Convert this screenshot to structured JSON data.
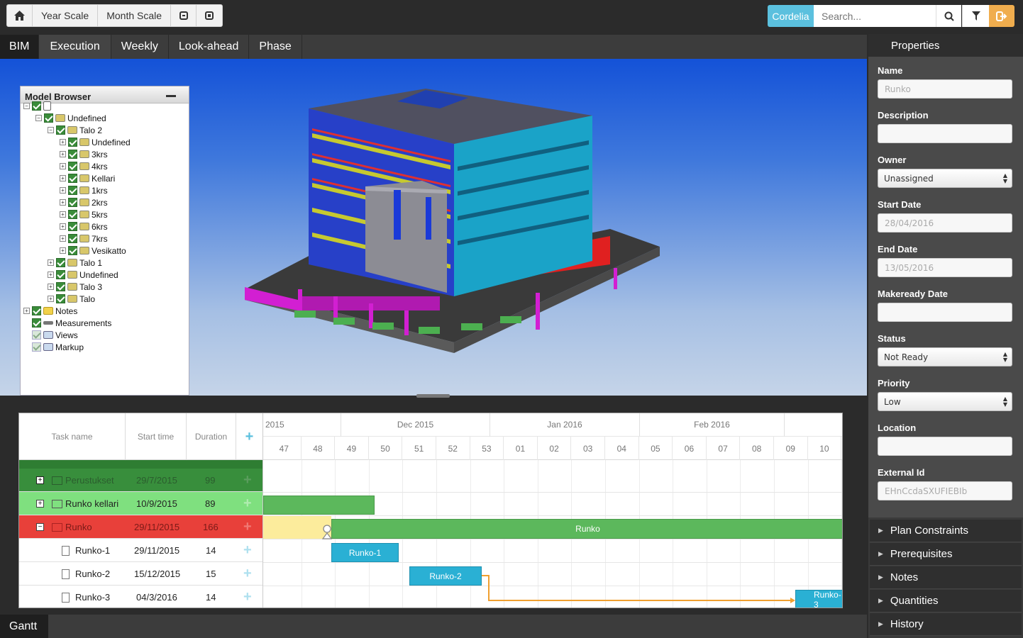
{
  "toolbar": {
    "home_icon": "home-icon",
    "year_scale": "Year Scale",
    "month_scale": "Month Scale",
    "expand_icon": "collapse-square-icon",
    "collapse_icon": "expand-square-icon",
    "user": "Cordelia",
    "search_placeholder": "Search...",
    "search_icon": "search-icon",
    "filter_icon": "filter-icon",
    "logout_icon": "sign-out-icon"
  },
  "tabs": [
    "BIM",
    "Execution",
    "Weekly",
    "Look-ahead",
    "Phase"
  ],
  "model_browser": {
    "title": "Model Browser",
    "nodes": [
      {
        "label": ""
      },
      {
        "label": "Undefined"
      },
      {
        "label": "Talo 2"
      },
      {
        "label": "Undefined"
      },
      {
        "label": "3krs"
      },
      {
        "label": "4krs"
      },
      {
        "label": "Kellari"
      },
      {
        "label": "1krs"
      },
      {
        "label": "2krs"
      },
      {
        "label": "5krs"
      },
      {
        "label": "6krs"
      },
      {
        "label": "7krs"
      },
      {
        "label": "Vesikatto"
      },
      {
        "label": "Talo 1"
      },
      {
        "label": "Undefined"
      },
      {
        "label": "Talo 3"
      },
      {
        "label": "Talo"
      },
      {
        "label": "Notes"
      },
      {
        "label": "Measurements"
      },
      {
        "label": "Views"
      },
      {
        "label": "Markup"
      }
    ]
  },
  "gantt": {
    "label": "Gantt",
    "columns": {
      "task": "Task name",
      "start": "Start time",
      "duration": "Duration"
    },
    "months": [
      "2015",
      "Dec 2015",
      "Jan 2016",
      "Feb 2016"
    ],
    "weeks": [
      "47",
      "48",
      "49",
      "50",
      "51",
      "52",
      "53",
      "01",
      "02",
      "03",
      "04",
      "05",
      "06",
      "07",
      "08",
      "09",
      "10"
    ],
    "rows": [
      {
        "name": "Perustukset",
        "start": "29/7/2015",
        "duration": "99"
      },
      {
        "name": "Runko kellari",
        "start": "10/9/2015",
        "duration": "89"
      },
      {
        "name": "Runko",
        "start": "29/11/2015",
        "duration": "166"
      },
      {
        "name": "Runko-1",
        "start": "29/11/2015",
        "duration": "14"
      },
      {
        "name": "Runko-2",
        "start": "15/12/2015",
        "duration": "15"
      },
      {
        "name": "Runko-3",
        "start": "04/3/2016",
        "duration": "14"
      }
    ],
    "bars": {
      "runko": "Runko",
      "runko1": "Runko-1",
      "runko2": "Runko-2",
      "runko3": "Runko-3"
    }
  },
  "properties": {
    "title": "Properties",
    "name_label": "Name",
    "name_value": "Runko",
    "description_label": "Description",
    "owner_label": "Owner",
    "owner_value": "Unassigned",
    "start_label": "Start Date",
    "start_value": "28/04/2016",
    "end_label": "End Date",
    "end_value": "13/05/2016",
    "makeready_label": "Makeready Date",
    "status_label": "Status",
    "status_value": "Not Ready",
    "priority_label": "Priority",
    "priority_value": "Low",
    "location_label": "Location",
    "external_label": "External Id",
    "external_value": "EHnCcdaSXUFIEBIb",
    "sections": [
      "Plan Constraints",
      "Prerequisites",
      "Notes",
      "Quantities",
      "History"
    ]
  }
}
